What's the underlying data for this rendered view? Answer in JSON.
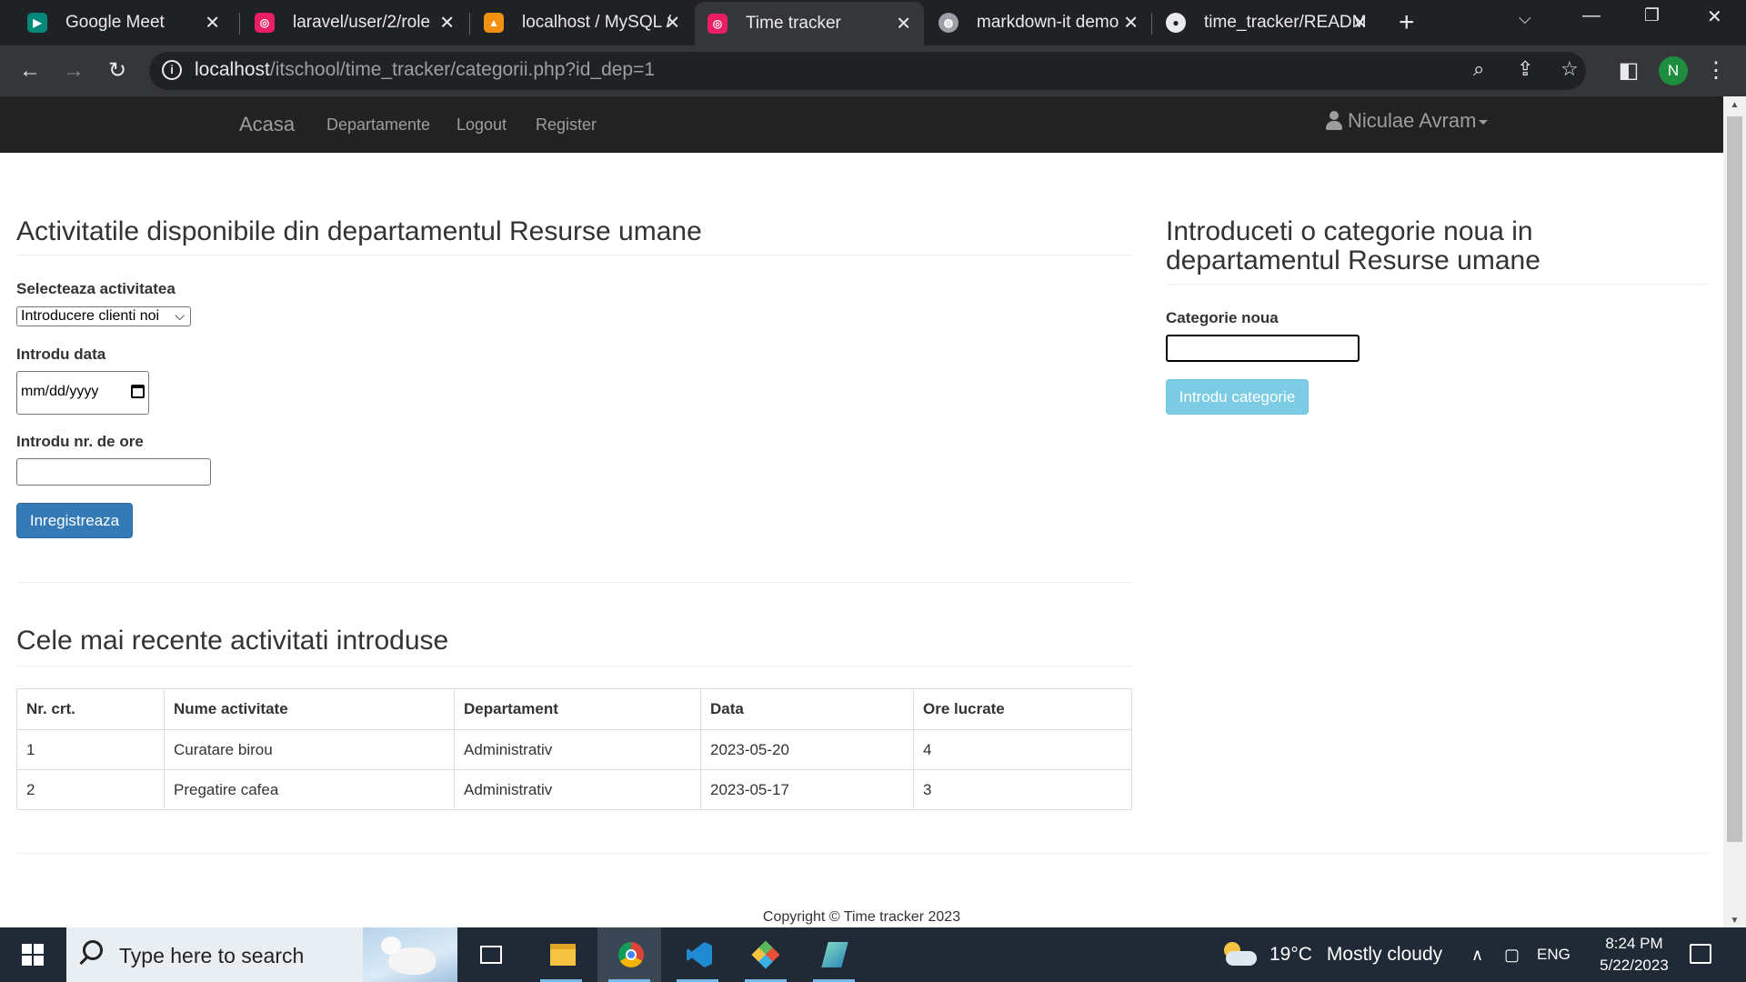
{
  "browser": {
    "tabs": [
      {
        "title": "Google Meet",
        "favicon_color": "#00897b",
        "active": false
      },
      {
        "title": "laravel/user/2/role",
        "favicon_color": "#e91e63",
        "active": false
      },
      {
        "title": "localhost / MySQL /",
        "favicon_color": "#f29111",
        "active": false
      },
      {
        "title": "Time tracker",
        "favicon_color": "#e91e63",
        "active": true
      },
      {
        "title": "markdown-it demo",
        "favicon_color": "#9aa0a6",
        "active": false
      },
      {
        "title": "time_tracker/READM",
        "favicon_color": "#e8eaed",
        "active": false
      }
    ],
    "url_host": "localhost",
    "url_path": "/itschool/time_tracker/categorii.php?id_dep=1",
    "profile_initial": "N"
  },
  "navbar": {
    "brand": "Acasa",
    "links": [
      "Departamente",
      "Logout",
      "Register"
    ],
    "user": "Niculae Avram"
  },
  "left": {
    "heading": "Activitatile disponibile din departamentul Resurse umane",
    "activity_label": "Selecteaza activitatea",
    "activity_selected": "Introducere clienti noi",
    "date_label": "Introdu data",
    "date_placeholder": "mm/dd/yyyy",
    "hours_label": "Introdu nr. de ore",
    "hours_value": "",
    "submit_label": "Inregistreaza"
  },
  "right": {
    "heading": "Introduceti o categorie noua in departamentul Resurse umane",
    "category_label": "Categorie noua",
    "category_value": "",
    "submit_label": "Introdu categorie"
  },
  "recent": {
    "heading": "Cele mai recente activitati introduse",
    "columns": [
      "Nr. crt.",
      "Nume activitate",
      "Departament",
      "Data",
      "Ore lucrate"
    ],
    "rows": [
      [
        "1",
        "Curatare birou",
        "Administrativ",
        "2023-05-20",
        "4"
      ],
      [
        "2",
        "Pregatire cafea",
        "Administrativ",
        "2023-05-17",
        "3"
      ]
    ]
  },
  "footer": {
    "text": "Copyright © Time tracker 2023"
  },
  "taskbar": {
    "search_placeholder": "Type here to search",
    "weather_temp": "19°C",
    "weather_desc": "Mostly cloudy",
    "language": "ENG",
    "time": "8:24 PM",
    "date": "5/22/2023"
  },
  "colors": {
    "navbar_bg": "#222222",
    "primary_button": "#337ab7",
    "info_button": "#5bc0de"
  }
}
